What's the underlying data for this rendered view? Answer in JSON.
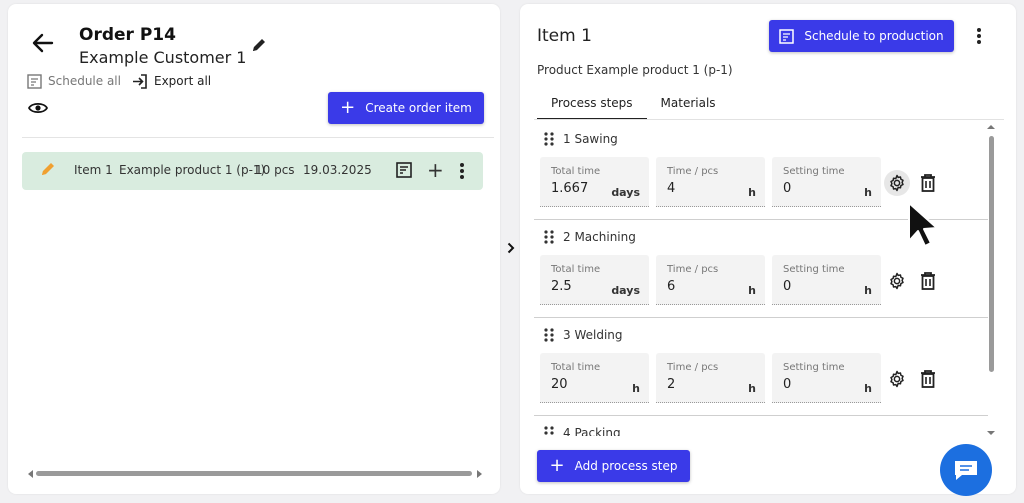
{
  "order": {
    "title": "Order P14",
    "customer": "Example Customer 1",
    "schedule_all_label": "Schedule all",
    "export_all_label": "Export all",
    "create_button_label": "Create order item",
    "rows": [
      {
        "name": "Item 1",
        "product": "Example product 1 (p-1)",
        "quantity": "10 pcs",
        "date": "19.03.2025"
      }
    ]
  },
  "item": {
    "title": "Item 1",
    "schedule_button_label": "Schedule to production",
    "product_line": "Product Example product 1 (p-1)",
    "tabs": [
      {
        "label": "Process steps",
        "active": true
      },
      {
        "label": "Materials",
        "active": false
      }
    ],
    "steps": [
      {
        "label": "1 Sawing",
        "fields": [
          {
            "label": "Total time",
            "value": "1.667",
            "unit": "days"
          },
          {
            "label": "Time / pcs",
            "value": "4",
            "unit": "h"
          },
          {
            "label": "Setting time",
            "value": "0",
            "unit": "h"
          }
        ]
      },
      {
        "label": "2 Machining",
        "fields": [
          {
            "label": "Total time",
            "value": "2.5",
            "unit": "days"
          },
          {
            "label": "Time / pcs",
            "value": "6",
            "unit": "h"
          },
          {
            "label": "Setting time",
            "value": "0",
            "unit": "h"
          }
        ]
      },
      {
        "label": "3 Welding",
        "fields": [
          {
            "label": "Total time",
            "value": "20",
            "unit": "h"
          },
          {
            "label": "Time / pcs",
            "value": "2",
            "unit": "h"
          },
          {
            "label": "Setting time",
            "value": "0",
            "unit": "h"
          }
        ]
      },
      {
        "label": "4 Packing"
      }
    ],
    "add_step_label": "Add process step"
  },
  "colors": {
    "accent": "#3a3ae8",
    "row_highlight": "#d9ecdf",
    "edit_pencil": "#f0a030",
    "chat_fab": "#1c6fe0"
  }
}
